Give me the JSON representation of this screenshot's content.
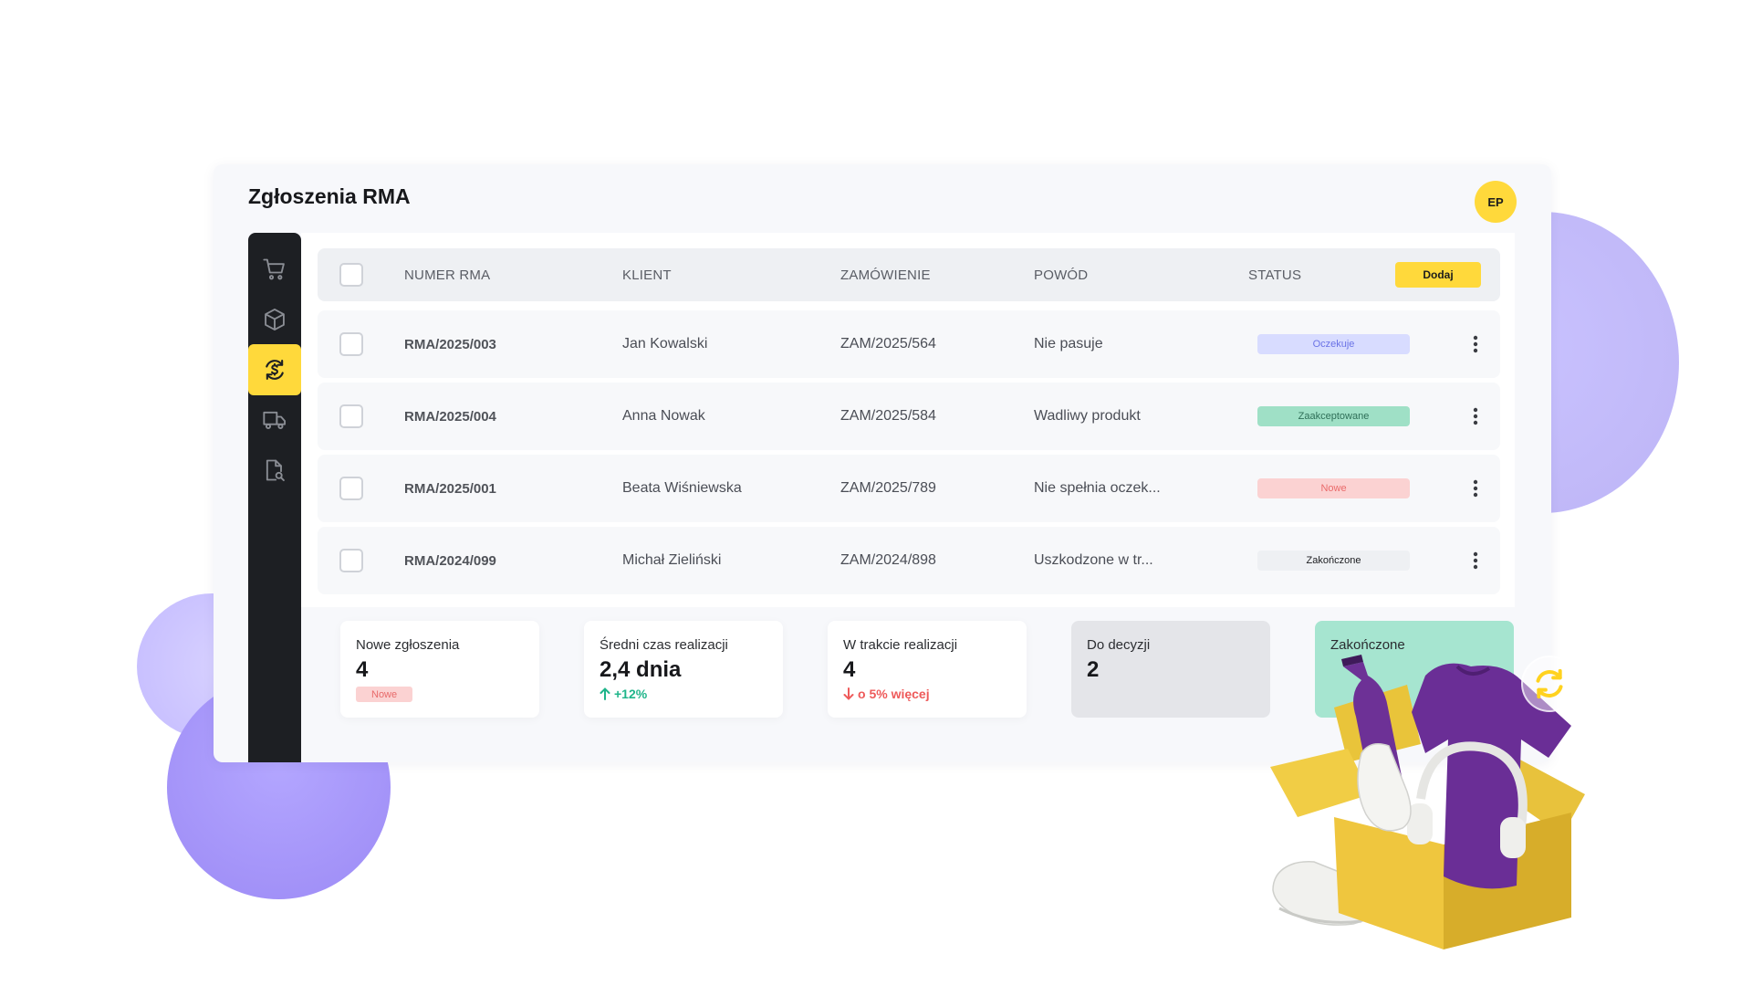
{
  "app": {
    "title": "Zgłoszenia RMA",
    "avatar_initials": "EP"
  },
  "colors": {
    "accent": "#ffd93b",
    "sidebar_bg": "#1d1f23",
    "lavender": "#c2baf9",
    "purple": "#9c8af5",
    "mint": "#a6e5d0"
  },
  "sidebar": {
    "items": [
      {
        "icon": "cart-icon",
        "active": false
      },
      {
        "icon": "box-icon",
        "active": false
      },
      {
        "icon": "returns-icon",
        "active": true
      },
      {
        "icon": "truck-icon",
        "active": false
      },
      {
        "icon": "document-search-icon",
        "active": false
      }
    ]
  },
  "table": {
    "headers": {
      "rma": "NUMER RMA",
      "client": "KLIENT",
      "order": "ZAMÓWIENIE",
      "reason": "POWÓD",
      "status": "STATUS"
    },
    "add_button": "Dodaj",
    "rows": [
      {
        "rma": "RMA/2025/003",
        "client": "Jan Kowalski",
        "order": "ZAM/2025/564",
        "reason": "Nie pasuje",
        "status": "Oczekuje",
        "status_bg": "#d8dcff",
        "status_fg": "#6b73e6"
      },
      {
        "rma": "RMA/2025/004",
        "client": "Anna Nowak",
        "order": "ZAM/2025/584",
        "reason": "Wadliwy produkt",
        "status": "Zaakceptowane",
        "status_bg": "#9fe0c6",
        "status_fg": "#2f6f58"
      },
      {
        "rma": "RMA/2025/001",
        "client": "Beata Wiśniewska",
        "order": "ZAM/2025/789",
        "reason": "Nie spełnia oczek...",
        "status": "Nowe",
        "status_bg": "#fbd2d2",
        "status_fg": "#ea6b6b"
      },
      {
        "rma": "RMA/2024/099",
        "client": "Michał Zieliński",
        "order": "ZAM/2024/898",
        "reason": "Uszkodzone w tr...",
        "status": "Zakończone",
        "status_bg": "#eef0f3",
        "status_fg": "#1c1d20"
      }
    ]
  },
  "stats": [
    {
      "label": "Nowe zgłoszenia",
      "value": "4",
      "badge": "Nowe"
    },
    {
      "label": "Średni czas realizacji",
      "value": "2,4 dnia",
      "change": "+12%",
      "change_color": "#1fb58a"
    },
    {
      "label": "W trakcie realizacji",
      "value": "4",
      "change": "o 5% więcej",
      "change_color": "#ee5a5a"
    },
    {
      "label": "Do decyzji",
      "value": "2"
    },
    {
      "label": "Zakończone"
    }
  ]
}
